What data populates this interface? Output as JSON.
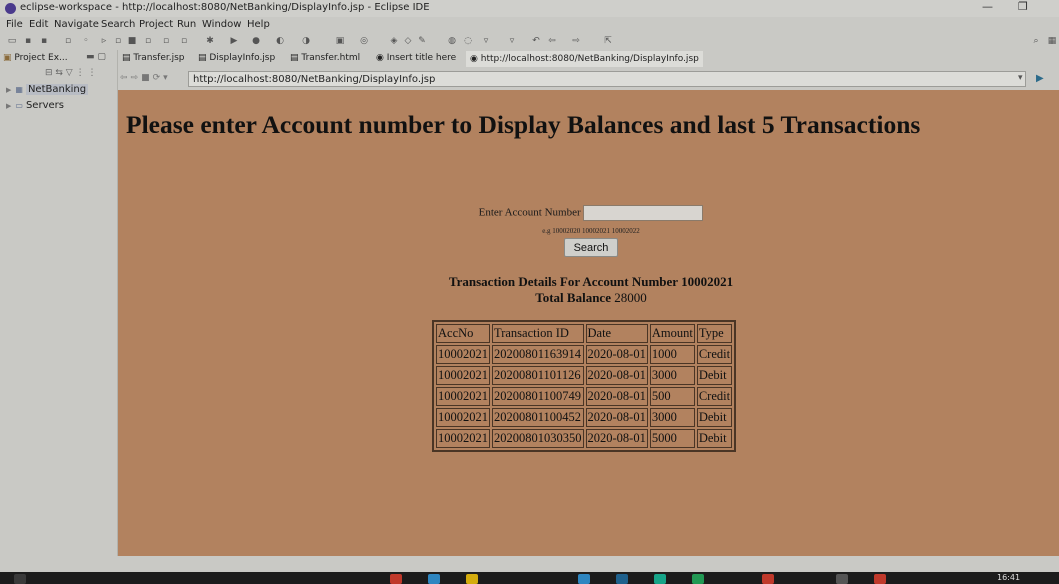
{
  "window": {
    "title": "eclipse-workspace - http://localhost:8080/NetBanking/DisplayInfo.jsp - Eclipse IDE",
    "minimize_glyph": "—",
    "restore_glyph": "❐"
  },
  "menubar": {
    "items": [
      "File",
      "Edit",
      "Navigate",
      "Search",
      "Project",
      "Run",
      "Window",
      "Help"
    ]
  },
  "explorer": {
    "tab_label": "Project Ex...",
    "tree": [
      {
        "label": "NetBanking",
        "selected": true
      },
      {
        "label": "Servers",
        "selected": false
      }
    ]
  },
  "editor_tabs": [
    {
      "label": "Transfer.jsp"
    },
    {
      "label": "DisplayInfo.jsp"
    },
    {
      "label": "Transfer.html"
    },
    {
      "label": "Insert title here"
    },
    {
      "label": "http://localhost:8080/NetBanking/DisplayInfo.jsp"
    }
  ],
  "browser": {
    "url": "http://localhost:8080/NetBanking/DisplayInfo.jsp"
  },
  "page": {
    "heading": "Please enter Account number to Display Balances and last 5 Transactions",
    "account_label": "Enter Account Number",
    "account_value": "",
    "example_text": "e.g 10002020 10002021 10002022",
    "search_button": "Search",
    "details_title": "Transaction Details For Account Number 10002021",
    "balance_label": "Total Balance",
    "balance_value": "28000"
  },
  "transactions": {
    "headers": [
      "AccNo",
      "Transaction ID",
      "Date",
      "Amount",
      "Type"
    ],
    "rows": [
      [
        "10002021",
        "20200801163914",
        "2020-08-01",
        "1000",
        "Credit"
      ],
      [
        "10002021",
        "20200801101126",
        "2020-08-01",
        "3000",
        "Debit"
      ],
      [
        "10002021",
        "20200801100749",
        "2020-08-01",
        "500",
        "Credit"
      ],
      [
        "10002021",
        "20200801100452",
        "2020-08-01",
        "3000",
        "Debit"
      ],
      [
        "10002021",
        "20200801030350",
        "2020-08-01",
        "5000",
        "Debit"
      ]
    ]
  },
  "taskbar": {
    "clock": "16:41"
  },
  "colors": {
    "page_background": "#b2825f",
    "ide_chrome": "#c9c9c5",
    "table_border": "#4a3525"
  }
}
